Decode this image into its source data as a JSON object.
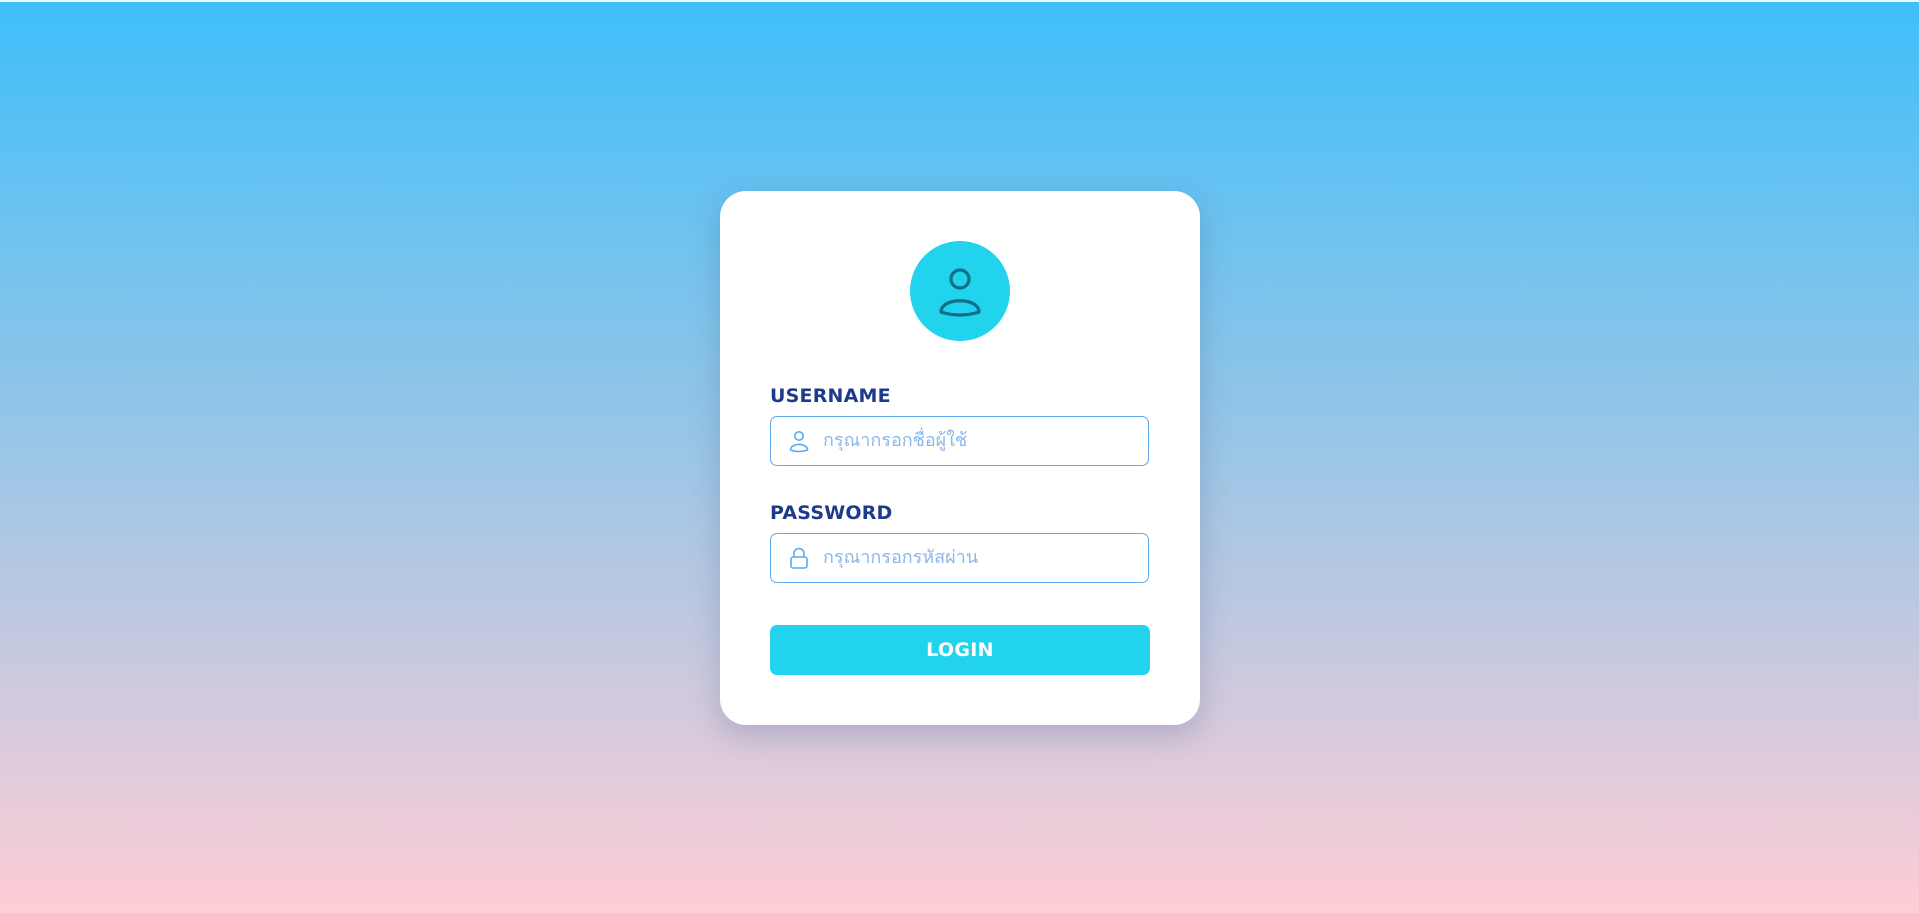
{
  "colors": {
    "gradient_top": "#3fbff9",
    "gradient_bottom": "#ffcdd6",
    "accent": "#22d3ee",
    "label": "#1e3a8a",
    "input_border": "#5aa9f0",
    "placeholder": "#8ab8ea"
  },
  "login_card": {
    "avatar_icon": "user-icon",
    "username": {
      "label": "USERNAME",
      "placeholder": "กรุณากรอกชื่อผู้ใช้",
      "value": "",
      "icon": "user-icon"
    },
    "password": {
      "label": "PASSWORD",
      "placeholder": "กรุณากรอกรหัสผ่าน",
      "value": "",
      "icon": "lock-icon"
    },
    "login_label": "LOGIN"
  }
}
